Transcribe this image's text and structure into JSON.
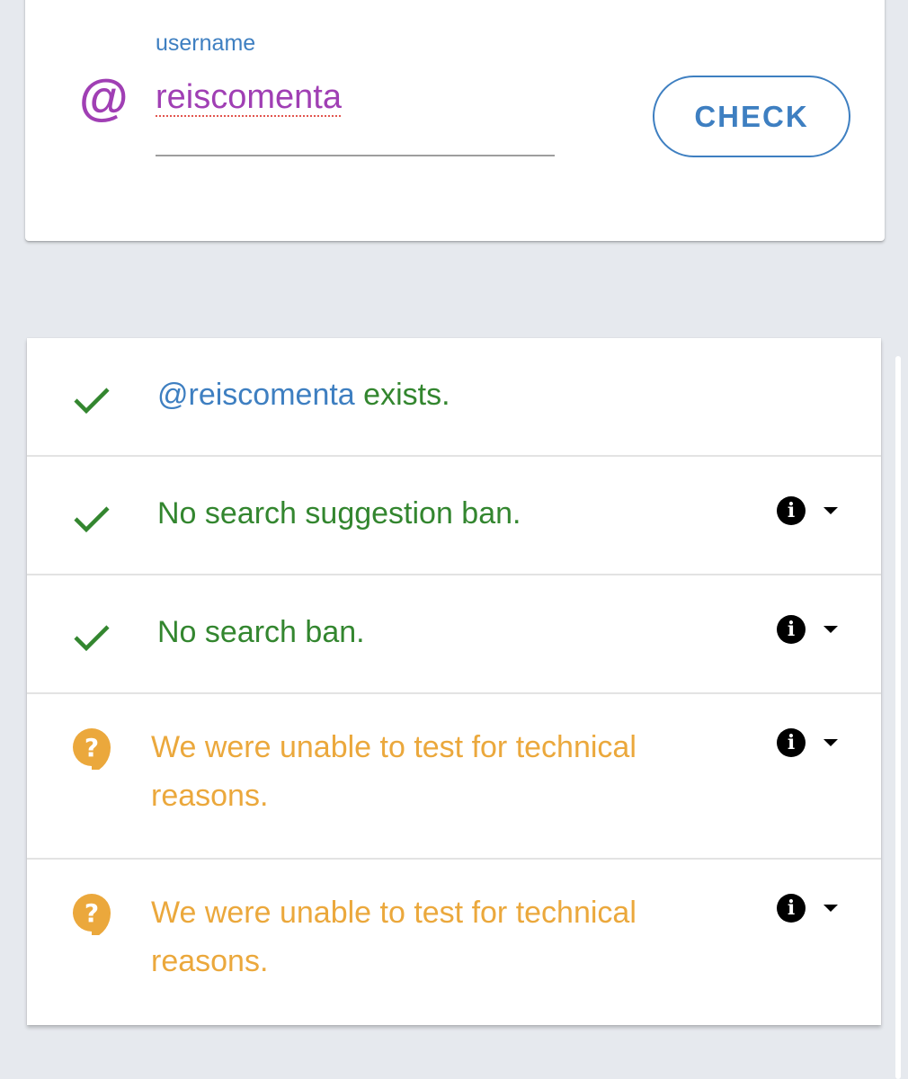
{
  "input_card": {
    "label": "username",
    "at_symbol": "@",
    "username_value": "reiscomenta",
    "check_label": "CHECK"
  },
  "results": [
    {
      "status": "success",
      "handle": "@reiscomenta",
      "text": " exists.",
      "has_details": false
    },
    {
      "status": "success",
      "text": "No search suggestion ban.",
      "has_details": true
    },
    {
      "status": "success",
      "text": "No search ban.",
      "has_details": true
    },
    {
      "status": "unknown",
      "text": "We were unable to test for technical reasons.",
      "has_details": true
    },
    {
      "status": "unknown",
      "text": "We were unable to test for technical reasons.",
      "has_details": true
    }
  ],
  "icons": {
    "success": "check-icon",
    "unknown": "question-bubble-icon",
    "info": "info-icon",
    "expand": "caret-down-icon"
  },
  "colors": {
    "accent_blue": "#3e7fc1",
    "username_purple": "#a03fb4",
    "success_green": "#33862f",
    "warning_orange": "#eba83c",
    "background": "#e6e9ee"
  }
}
